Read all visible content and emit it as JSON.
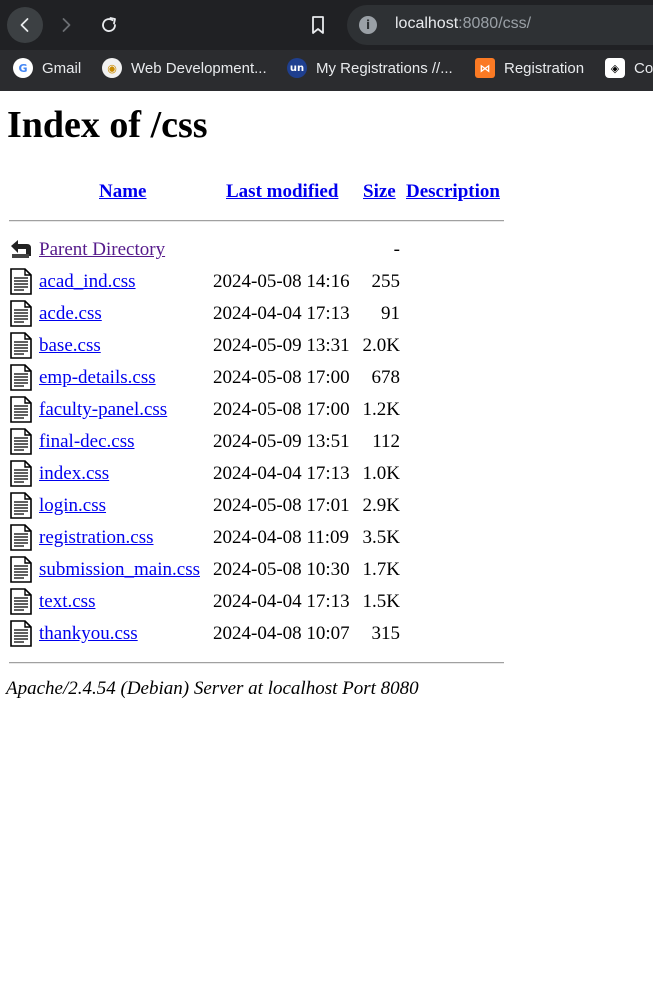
{
  "browser": {
    "url_host": "localhost",
    "url_rest": ":8080/css/",
    "bookmarks": [
      {
        "label": "Gmail",
        "icon": "google-icon"
      },
      {
        "label": "Web Development...",
        "icon": "webdev-icon"
      },
      {
        "label": "My Registrations //...",
        "icon": "un-icon"
      },
      {
        "label": "Registration",
        "icon": "xampp-icon"
      },
      {
        "label": "Co",
        "icon": "codepen-icon"
      }
    ]
  },
  "page": {
    "title": "Index of /css",
    "columns": {
      "name": "Name",
      "last_modified": "Last modified",
      "size": "Size",
      "description": "Description"
    },
    "parent": {
      "name": "Parent Directory",
      "size": "-"
    },
    "files": [
      {
        "name": "acad_ind.css",
        "modified": "2024-05-08 14:16",
        "size": "255"
      },
      {
        "name": "acde.css",
        "modified": "2024-04-04 17:13",
        "size": "91"
      },
      {
        "name": "base.css",
        "modified": "2024-05-09 13:31",
        "size": "2.0K"
      },
      {
        "name": "emp-details.css",
        "modified": "2024-05-08 17:00",
        "size": "678"
      },
      {
        "name": "faculty-panel.css",
        "modified": "2024-05-08 17:00",
        "size": "1.2K"
      },
      {
        "name": "final-dec.css",
        "modified": "2024-05-09 13:51",
        "size": "112"
      },
      {
        "name": "index.css",
        "modified": "2024-04-04 17:13",
        "size": "1.0K"
      },
      {
        "name": "login.css",
        "modified": "2024-05-08 17:01",
        "size": "2.9K"
      },
      {
        "name": "registration.css",
        "modified": "2024-04-08 11:09",
        "size": "3.5K"
      },
      {
        "name": "submission_main.css",
        "modified": "2024-05-08 10:30",
        "size": "1.7K"
      },
      {
        "name": "text.css",
        "modified": "2024-04-04 17:13",
        "size": "1.5K"
      },
      {
        "name": "thankyou.css",
        "modified": "2024-04-08 10:07",
        "size": "315"
      }
    ],
    "footer": "Apache/2.4.54 (Debian) Server at localhost Port 8080"
  }
}
